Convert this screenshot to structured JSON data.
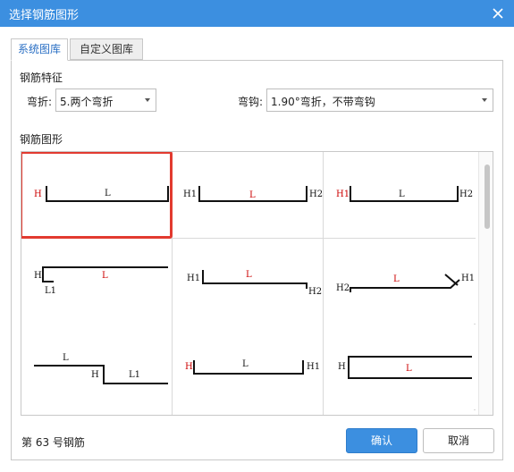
{
  "window": {
    "title": "选择钢筋图形"
  },
  "tabs": [
    {
      "label": "系统图库",
      "active": true
    },
    {
      "label": "自定义图库",
      "active": false
    }
  ],
  "features": {
    "heading": "钢筋特征",
    "bend_label": "弯折:",
    "bend_value": "5.两个弯折",
    "hook_label": "弯钩:",
    "hook_value": "1.90°弯折，不带弯钩"
  },
  "shapes_heading": "钢筋图形",
  "shapes": [
    {
      "labels": [
        "H",
        "L"
      ]
    },
    {
      "labels": [
        "H1",
        "L",
        "H2"
      ]
    },
    {
      "labels": [
        "H1",
        "L",
        "H2"
      ]
    },
    {
      "labels": [
        "H",
        "L",
        "L1"
      ]
    },
    {
      "labels": [
        "H1",
        "L",
        "H2"
      ]
    },
    {
      "labels": [
        "L",
        "H1",
        "H2"
      ]
    },
    {
      "labels": [
        "L",
        "H",
        "L1"
      ]
    },
    {
      "labels": [
        "H",
        "L",
        "H1"
      ]
    },
    {
      "labels": [
        "H",
        "L"
      ]
    }
  ],
  "selected_index": 0,
  "status": "第 63 号钢筋",
  "buttons": {
    "ok": "确认",
    "cancel": "取消"
  },
  "colors": {
    "accent": "#3c8fe0",
    "selection": "#e23a2f",
    "label_red": "#cc0000"
  }
}
